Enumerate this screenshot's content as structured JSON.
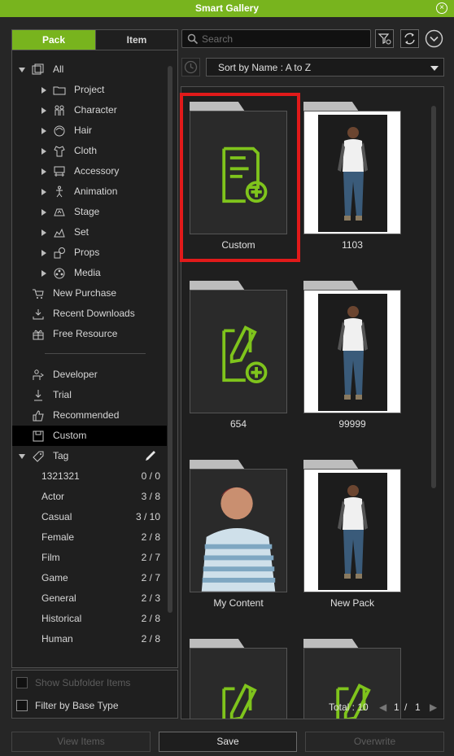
{
  "window": {
    "title": "Smart Gallery",
    "close_icon": "close-icon"
  },
  "tabs": {
    "pack": "Pack",
    "item": "Item"
  },
  "tree": [
    {
      "label": "All",
      "icon": "all-icon",
      "arrow": "down"
    },
    {
      "label": "Project",
      "icon": "folder-icon",
      "arrow": "right"
    },
    {
      "label": "Character",
      "icon": "character-icon",
      "arrow": "right"
    },
    {
      "label": "Hair",
      "icon": "hair-icon",
      "arrow": "right"
    },
    {
      "label": "Cloth",
      "icon": "cloth-icon",
      "arrow": "right"
    },
    {
      "label": "Accessory",
      "icon": "accessory-icon",
      "arrow": "right"
    },
    {
      "label": "Animation",
      "icon": "animation-icon",
      "arrow": "right"
    },
    {
      "label": "Stage",
      "icon": "stage-icon",
      "arrow": "right"
    },
    {
      "label": "Set",
      "icon": "set-icon",
      "arrow": "right"
    },
    {
      "label": "Props",
      "icon": "props-icon",
      "arrow": "right"
    },
    {
      "label": "Media",
      "icon": "media-icon",
      "arrow": "right"
    },
    {
      "label": "New Purchase",
      "icon": "cart-icon"
    },
    {
      "label": "Recent Downloads",
      "icon": "download-icon"
    },
    {
      "label": "Free Resource",
      "icon": "gift-icon"
    },
    {
      "label": "Developer",
      "icon": "developer-icon"
    },
    {
      "label": "Trial",
      "icon": "trial-icon"
    },
    {
      "label": "Recommended",
      "icon": "thumbs-up-icon"
    },
    {
      "label": "Custom",
      "icon": "custom-icon",
      "selected": true
    },
    {
      "label": "Tag",
      "icon": "tag-icon",
      "arrow": "down"
    }
  ],
  "tags": [
    {
      "label": "1321321",
      "count": "0 / 0"
    },
    {
      "label": "Actor",
      "count": "3 / 8"
    },
    {
      "label": "Casual",
      "count": "3 / 10"
    },
    {
      "label": "Female",
      "count": "2 / 8"
    },
    {
      "label": "Film",
      "count": "2 / 7"
    },
    {
      "label": "Game",
      "count": "2 / 7"
    },
    {
      "label": "General",
      "count": "2 / 3"
    },
    {
      "label": "Historical",
      "count": "2 / 8"
    },
    {
      "label": "Human",
      "count": "2 / 8"
    }
  ],
  "options": {
    "show_subfolder": "Show Subfolder Items",
    "filter_base": "Filter by Base Type"
  },
  "search": {
    "placeholder": "Search"
  },
  "sort": {
    "value": "Sort by Name : A to Z"
  },
  "items": [
    {
      "label": "Custom",
      "kind": "custom",
      "selected": true
    },
    {
      "label": "1103",
      "kind": "person"
    },
    {
      "label": "654",
      "kind": "edit"
    },
    {
      "label": "99999",
      "kind": "person"
    },
    {
      "label": "My Content",
      "kind": "man"
    },
    {
      "label": "New Pack",
      "kind": "person"
    },
    {
      "label": "",
      "kind": "edit-partial"
    },
    {
      "label": "",
      "kind": "edit-partial"
    }
  ],
  "footer": {
    "total": "Total : 10",
    "page": "1",
    "sep": "/",
    "pages": "1"
  },
  "buttons": {
    "view_items": "View Items",
    "save": "Save",
    "overwrite": "Overwrite"
  },
  "colors": {
    "accent": "#78b41e",
    "selection": "#e11a1a"
  }
}
